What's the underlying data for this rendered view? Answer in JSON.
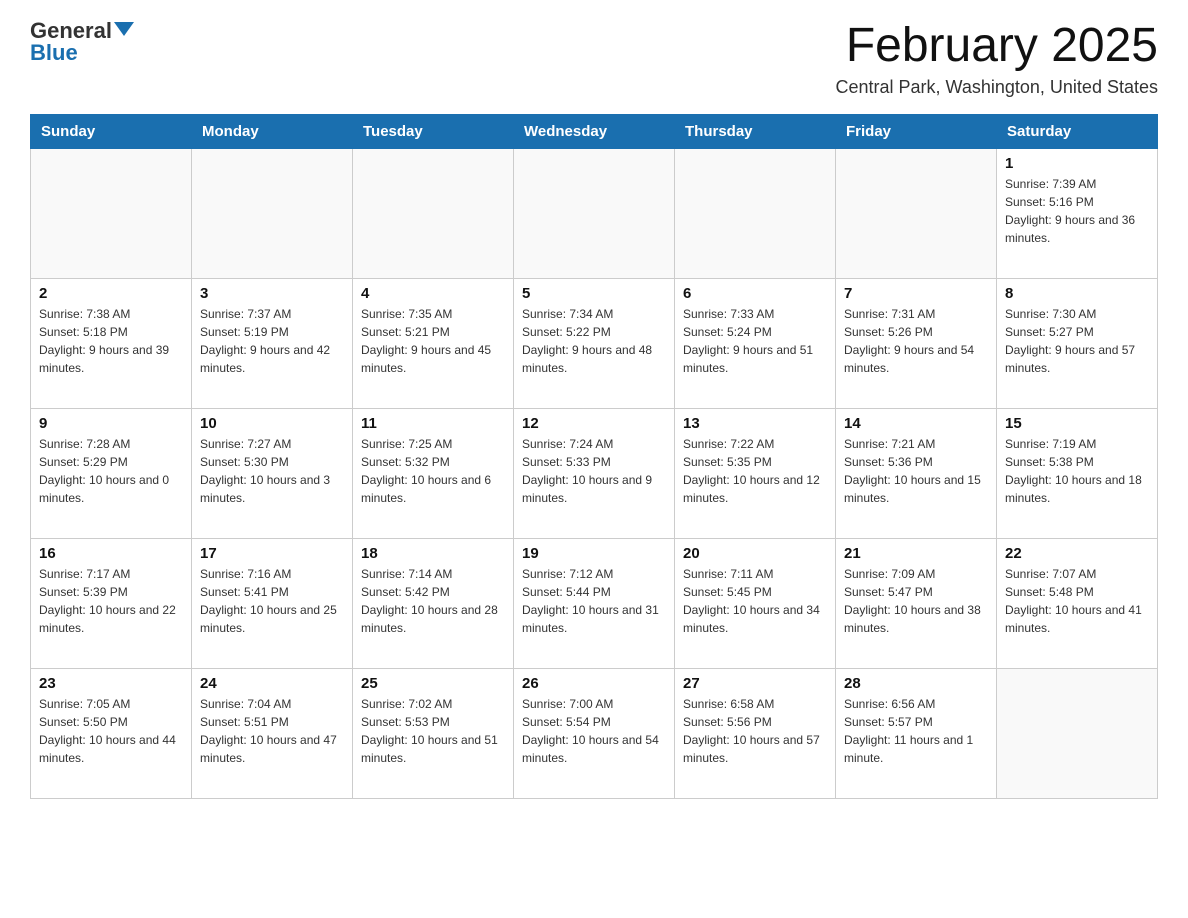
{
  "header": {
    "logo_general": "General",
    "logo_blue": "Blue",
    "month_title": "February 2025",
    "location": "Central Park, Washington, United States"
  },
  "days_of_week": [
    "Sunday",
    "Monday",
    "Tuesday",
    "Wednesday",
    "Thursday",
    "Friday",
    "Saturday"
  ],
  "weeks": [
    [
      {
        "day": "",
        "info": ""
      },
      {
        "day": "",
        "info": ""
      },
      {
        "day": "",
        "info": ""
      },
      {
        "day": "",
        "info": ""
      },
      {
        "day": "",
        "info": ""
      },
      {
        "day": "",
        "info": ""
      },
      {
        "day": "1",
        "info": "Sunrise: 7:39 AM\nSunset: 5:16 PM\nDaylight: 9 hours and 36 minutes."
      }
    ],
    [
      {
        "day": "2",
        "info": "Sunrise: 7:38 AM\nSunset: 5:18 PM\nDaylight: 9 hours and 39 minutes."
      },
      {
        "day": "3",
        "info": "Sunrise: 7:37 AM\nSunset: 5:19 PM\nDaylight: 9 hours and 42 minutes."
      },
      {
        "day": "4",
        "info": "Sunrise: 7:35 AM\nSunset: 5:21 PM\nDaylight: 9 hours and 45 minutes."
      },
      {
        "day": "5",
        "info": "Sunrise: 7:34 AM\nSunset: 5:22 PM\nDaylight: 9 hours and 48 minutes."
      },
      {
        "day": "6",
        "info": "Sunrise: 7:33 AM\nSunset: 5:24 PM\nDaylight: 9 hours and 51 minutes."
      },
      {
        "day": "7",
        "info": "Sunrise: 7:31 AM\nSunset: 5:26 PM\nDaylight: 9 hours and 54 minutes."
      },
      {
        "day": "8",
        "info": "Sunrise: 7:30 AM\nSunset: 5:27 PM\nDaylight: 9 hours and 57 minutes."
      }
    ],
    [
      {
        "day": "9",
        "info": "Sunrise: 7:28 AM\nSunset: 5:29 PM\nDaylight: 10 hours and 0 minutes."
      },
      {
        "day": "10",
        "info": "Sunrise: 7:27 AM\nSunset: 5:30 PM\nDaylight: 10 hours and 3 minutes."
      },
      {
        "day": "11",
        "info": "Sunrise: 7:25 AM\nSunset: 5:32 PM\nDaylight: 10 hours and 6 minutes."
      },
      {
        "day": "12",
        "info": "Sunrise: 7:24 AM\nSunset: 5:33 PM\nDaylight: 10 hours and 9 minutes."
      },
      {
        "day": "13",
        "info": "Sunrise: 7:22 AM\nSunset: 5:35 PM\nDaylight: 10 hours and 12 minutes."
      },
      {
        "day": "14",
        "info": "Sunrise: 7:21 AM\nSunset: 5:36 PM\nDaylight: 10 hours and 15 minutes."
      },
      {
        "day": "15",
        "info": "Sunrise: 7:19 AM\nSunset: 5:38 PM\nDaylight: 10 hours and 18 minutes."
      }
    ],
    [
      {
        "day": "16",
        "info": "Sunrise: 7:17 AM\nSunset: 5:39 PM\nDaylight: 10 hours and 22 minutes."
      },
      {
        "day": "17",
        "info": "Sunrise: 7:16 AM\nSunset: 5:41 PM\nDaylight: 10 hours and 25 minutes."
      },
      {
        "day": "18",
        "info": "Sunrise: 7:14 AM\nSunset: 5:42 PM\nDaylight: 10 hours and 28 minutes."
      },
      {
        "day": "19",
        "info": "Sunrise: 7:12 AM\nSunset: 5:44 PM\nDaylight: 10 hours and 31 minutes."
      },
      {
        "day": "20",
        "info": "Sunrise: 7:11 AM\nSunset: 5:45 PM\nDaylight: 10 hours and 34 minutes."
      },
      {
        "day": "21",
        "info": "Sunrise: 7:09 AM\nSunset: 5:47 PM\nDaylight: 10 hours and 38 minutes."
      },
      {
        "day": "22",
        "info": "Sunrise: 7:07 AM\nSunset: 5:48 PM\nDaylight: 10 hours and 41 minutes."
      }
    ],
    [
      {
        "day": "23",
        "info": "Sunrise: 7:05 AM\nSunset: 5:50 PM\nDaylight: 10 hours and 44 minutes."
      },
      {
        "day": "24",
        "info": "Sunrise: 7:04 AM\nSunset: 5:51 PM\nDaylight: 10 hours and 47 minutes."
      },
      {
        "day": "25",
        "info": "Sunrise: 7:02 AM\nSunset: 5:53 PM\nDaylight: 10 hours and 51 minutes."
      },
      {
        "day": "26",
        "info": "Sunrise: 7:00 AM\nSunset: 5:54 PM\nDaylight: 10 hours and 54 minutes."
      },
      {
        "day": "27",
        "info": "Sunrise: 6:58 AM\nSunset: 5:56 PM\nDaylight: 10 hours and 57 minutes."
      },
      {
        "day": "28",
        "info": "Sunrise: 6:56 AM\nSunset: 5:57 PM\nDaylight: 11 hours and 1 minute."
      },
      {
        "day": "",
        "info": ""
      }
    ]
  ]
}
